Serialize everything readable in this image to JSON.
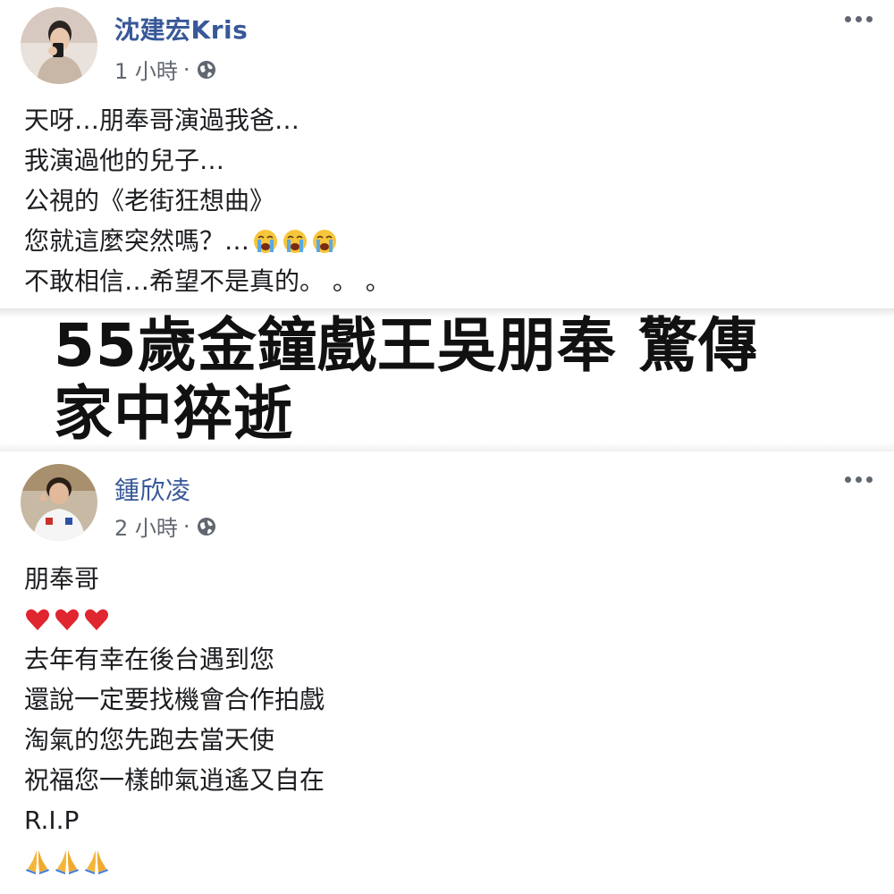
{
  "posts": [
    {
      "author": "沈建宏Kris",
      "time": "1 小時",
      "separator": "·",
      "lines": [
        "天呀…朋奉哥演過我爸…",
        "我演過他的兒子…",
        "公視的《老街狂想曲》",
        "您就這麼突然嗎？…",
        "不敢相信…希望不是真的。 。 。"
      ],
      "emoji_after_line_4": [
        "crying-face",
        "crying-face",
        "crying-face"
      ]
    },
    {
      "author": "鍾欣凌",
      "time": "2 小時",
      "separator": "·",
      "lines_before_hearts": [
        "朋奉哥"
      ],
      "hearts": [
        "red-heart",
        "red-heart",
        "red-heart"
      ],
      "lines_after_hearts": [
        "去年有幸在後台遇到您",
        "還說一定要找機會合作拍戲",
        "淘氣的您先跑去當天使",
        "祝福您一樣帥氣逍遙又自在",
        "R.I.P"
      ],
      "prayers": [
        "folded-hands",
        "folded-hands",
        "folded-hands"
      ]
    }
  ],
  "headline": {
    "line1": "55歲金鐘戲王吳朋奉 驚傳",
    "line2": "家中猝逝"
  },
  "colors": {
    "author": "#385898",
    "meta": "#606770",
    "text": "#1c1e21"
  }
}
